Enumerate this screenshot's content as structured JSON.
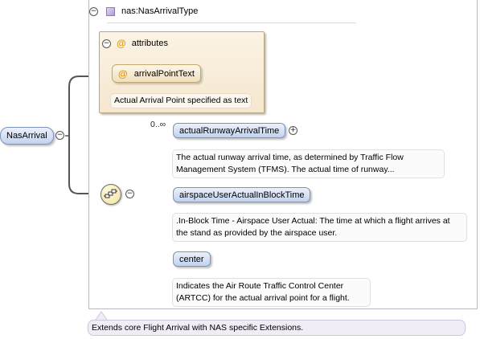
{
  "root": {
    "name": "NasArrival",
    "toggle": "−"
  },
  "type": {
    "name": "nas:NasArrivalType",
    "toggle": "−"
  },
  "attributes": {
    "label": "attributes",
    "toggle": "−",
    "at_symbol": "@",
    "items": [
      {
        "name": "arrivalPointText",
        "doc": "Actual Arrival Point specified as text"
      }
    ]
  },
  "sequence": {
    "toggle": "−",
    "icon": "sequence-compositor-icon"
  },
  "elements": [
    {
      "name": "actualRunwayArrivalTime",
      "occurrence": "0..∞",
      "expand": "+",
      "doc_lines": [
        "The actual runway arrival time, as determined by Traffic Flow",
        "Management System (TFMS). The actual time of runway..."
      ]
    },
    {
      "name": "airspaceUserActualInBlockTime",
      "doc_lines": [
        ".In-Block Time - Airspace User Actual: The time at which a flight arrives at",
        "the stand as provided by the airspace user."
      ]
    },
    {
      "name": "center",
      "doc_lines": [
        "Indicates the Air Route Traffic Control Center",
        "(ARTCC) for the actual arrival point for a flight."
      ]
    }
  ],
  "extension_note": "Extends core Flight Arrival with NAS specific Extensions.",
  "colors": {
    "element_fill": "#c2d2ee",
    "attribute_fill": "#f5e7cf",
    "type_icon": "#b09bd2",
    "connector": "#555555"
  }
}
